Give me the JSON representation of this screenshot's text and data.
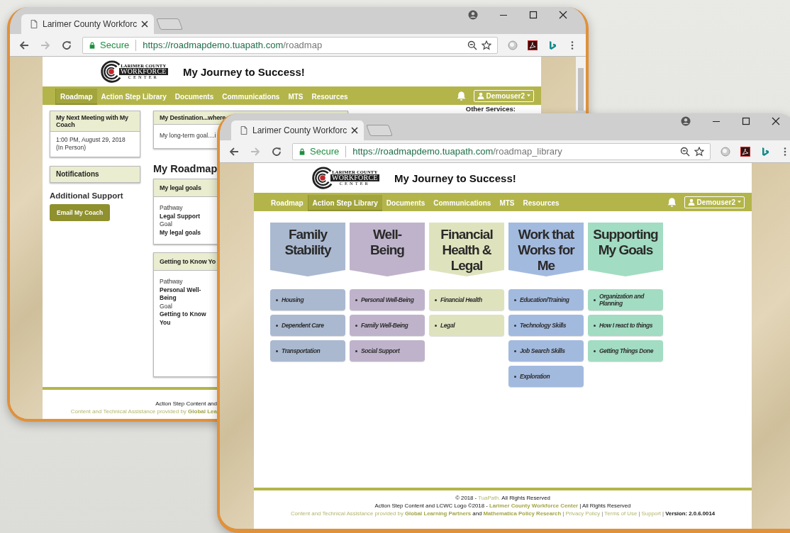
{
  "back_window": {
    "tab_title": "Larimer County Workforc",
    "secure_label": "Secure",
    "url_host": "https://roadmapdemo.tuapath.com",
    "url_path": "/roadmap",
    "logo": {
      "line_1": "LARIMER COUNTY",
      "line_2": "WORKFORCE",
      "line_3": "CENTER"
    },
    "page_title": "My Journey to Success!",
    "nav": [
      {
        "label": "Roadmap",
        "selected": true
      },
      {
        "label": "Action Step Library",
        "selected": false
      },
      {
        "label": "Documents",
        "selected": false
      },
      {
        "label": "Communications",
        "selected": false
      },
      {
        "label": "MTS",
        "selected": false
      },
      {
        "label": "Resources",
        "selected": false
      }
    ],
    "user_menu": "Demouser2",
    "meeting_card": {
      "title": "My Next Meeting with My Coach",
      "lines": [
        "1:00 PM, August 29, 2018",
        "(In Person)"
      ]
    },
    "notifications_card": {
      "title": "Notifications"
    },
    "additional_support": {
      "heading": "Additional Support",
      "button": "Email My Coach"
    },
    "destination_card": {
      "title": "My Destination...where",
      "body": "My long-term goal....i"
    },
    "roadmap_heading": "My Roadmap",
    "goal_cards": [
      {
        "title": "My legal goals",
        "fields": [
          {
            "label": "Pathway",
            "value": "Legal Support"
          },
          {
            "label": "Goal",
            "value": "My legal goals"
          }
        ]
      },
      {
        "title": "Getting to Know Yo",
        "fields": [
          {
            "label": "Pathway",
            "value": "Personal Well-Being"
          },
          {
            "label": "Goal",
            "value": "Getting to Know You"
          }
        ]
      }
    ],
    "other_services": "Other Services:",
    "footer_lines": [
      [
        {
          "kind": "text",
          "text": "Action Step Content and"
        }
      ],
      [
        {
          "kind": "muted",
          "text": "Content and Technical Assistance provided by"
        },
        {
          "kind": "bold-link",
          "text": "Global Lea"
        }
      ]
    ]
  },
  "front_window": {
    "tab_title": "Larimer County Workforc",
    "secure_label": "Secure",
    "url_host": "https://roadmapdemo.tuapath.com",
    "url_path": "/roadmap_library",
    "logo": {
      "line_1": "LARIMER COUNTY",
      "line_2": "WORKFORCE",
      "line_3": "CENTER"
    },
    "page_title": "My Journey to Success!",
    "nav": [
      {
        "label": "Roadmap",
        "selected": false
      },
      {
        "label": "Action Step Library",
        "selected": true
      },
      {
        "label": "Documents",
        "selected": false
      },
      {
        "label": "Communications",
        "selected": false
      },
      {
        "label": "MTS",
        "selected": false
      },
      {
        "label": "Resources",
        "selected": false
      }
    ],
    "user_menu": "Demouser2",
    "categories": [
      {
        "title": "Family\nStability",
        "color": "#aab9d0",
        "items": [
          "Housing",
          "Dependent Care",
          "Transportation"
        ]
      },
      {
        "title": "Well-\nBeing",
        "color": "#bfb3cb",
        "items": [
          "Personal Well-Being",
          "Family Well-Being",
          "Social Support"
        ]
      },
      {
        "title": "Financial\nHealth &\nLegal",
        "color": "#dfe3bd",
        "items": [
          "Financial Health",
          "Legal"
        ]
      },
      {
        "title": "Work that\nWorks for\nMe",
        "color": "#a3badf",
        "items": [
          "Education/Training",
          "Technology Skills",
          "Job Search Skills",
          "Exploration"
        ]
      },
      {
        "title": "Supporting\nMy Goals",
        "color": "#a2dcc2",
        "items": [
          "Organization and Planning",
          "How I react to things",
          "Getting Things Done"
        ]
      }
    ],
    "footer_lines": [
      [
        {
          "kind": "text",
          "text": "© 2018 -"
        },
        {
          "kind": "link",
          "text": "TuaPath."
        },
        {
          "kind": "text",
          "text": "All Rights Reserved"
        }
      ],
      [
        {
          "kind": "text",
          "text": "Action Step Content and LCWC Logo ©2018 -"
        },
        {
          "kind": "bold-link",
          "text": "Larimer County Workforce Center"
        },
        {
          "kind": "text",
          "text": "| All Rights Reserved"
        }
      ],
      [
        {
          "kind": "muted",
          "text": "Content and Technical Assistance provided by"
        },
        {
          "kind": "bold-link",
          "text": "Global Learning Partners"
        },
        {
          "kind": "text",
          "text": "and"
        },
        {
          "kind": "bold-link",
          "text": "Mathematica Policy Research"
        },
        {
          "kind": "sep",
          "text": "|"
        },
        {
          "kind": "link",
          "text": "Privacy Policy"
        },
        {
          "kind": "sep",
          "text": "|"
        },
        {
          "kind": "link",
          "text": "Terms of Use"
        },
        {
          "kind": "sep",
          "text": "|"
        },
        {
          "kind": "link",
          "text": "Support"
        },
        {
          "kind": "sep",
          "text": "|"
        },
        {
          "kind": "strong",
          "text": "Version: 2.0.6.0014"
        }
      ]
    ]
  }
}
